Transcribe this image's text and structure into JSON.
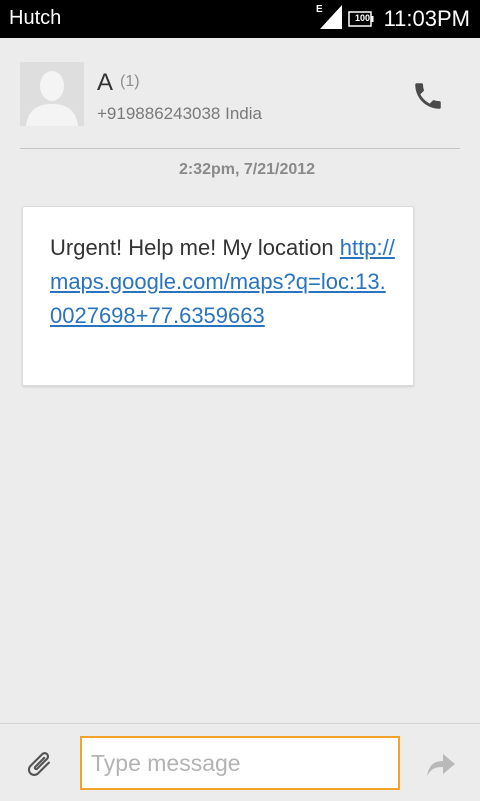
{
  "status_bar": {
    "carrier": "Hutch",
    "network_type": "E",
    "battery_level": "100",
    "time": "11:03PM"
  },
  "contact": {
    "name": "A",
    "message_count": "(1)",
    "number": "+919886243038 India"
  },
  "conversation": {
    "timestamp": "2:32pm, 7/21/2012",
    "messages": [
      {
        "text": "Urgent! Help me! My location ",
        "link": "http://maps.google.com/maps?q=loc:13.0027698+77.6359663"
      }
    ]
  },
  "composer": {
    "placeholder": "Type message",
    "value": ""
  },
  "icons": {
    "attach": "paperclip-icon",
    "send": "send-arrow-icon",
    "call": "phone-icon"
  },
  "colors": {
    "link": "#2a74bf",
    "input_focus_border": "#f2a328"
  }
}
